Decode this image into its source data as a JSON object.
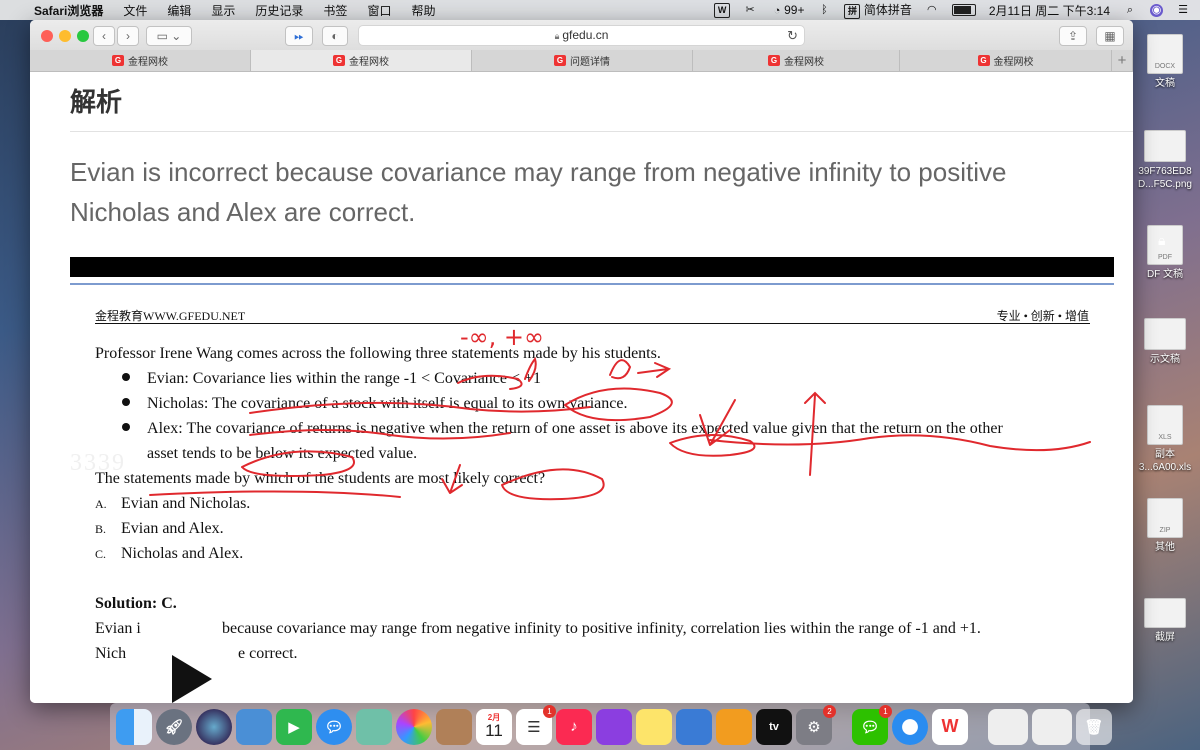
{
  "menubar": {
    "app_name": "Safari浏览器",
    "menus": [
      "文件",
      "编辑",
      "显示",
      "历史记录",
      "书签",
      "窗口",
      "帮助"
    ],
    "wechat_badge": "99+",
    "input_method": "简体拼音",
    "datetime": "2月11日 周二 下午3:14"
  },
  "safari": {
    "url": "gfedu.cn",
    "tabs": [
      {
        "label": "金程网校",
        "active": false
      },
      {
        "label": "金程网校",
        "active": true
      },
      {
        "label": "问题详情",
        "active": false
      },
      {
        "label": "金程网校",
        "active": false
      },
      {
        "label": "金程网校",
        "active": false
      }
    ]
  },
  "page": {
    "heading": "解析",
    "explanation_line1": "Evian is incorrect because covariance may range from negative infinity to positive",
    "explanation_line2": "Nicholas and Alex are correct."
  },
  "scan": {
    "header_left": "金程教育WWW.GFEDU.NET",
    "header_right": "专业 • 创新 • 增值",
    "question": "Professor Irene Wang comes across the following three statements made by his students.",
    "bullets": [
      "Evian: Covariance lies within the range -1 < Covariance < +1",
      "Nicholas: The covariance of a stock with itself is equal to its own variance.",
      "Alex: The covariance of returns is negative when the return of one asset is above its expected value given that the return on the other",
      "asset tends to be below its expected value."
    ],
    "prompt": "The statements made by which of the students are most likely correct?",
    "options": [
      {
        "letter": "A.",
        "text": "Evian and Nicholas."
      },
      {
        "letter": "B.",
        "text": "Evian and Alex."
      },
      {
        "letter": "C.",
        "text": "Nicholas and Alex."
      }
    ],
    "solution_label": "Solution: C.",
    "solution_line1_a": "Evian i",
    "solution_line1_b": "because covariance may range from negative infinity to positive infinity, correlation lies within the range of -1 and +1.",
    "solution_line2_a": "Nich",
    "solution_line2_b": "e correct.",
    "annotation_text": "-∞, +∞"
  },
  "desktop_icons": [
    {
      "label": "文稿",
      "tag": "DOCX"
    },
    {
      "label": "39F763ED8\nD...F5C.png",
      "tag": ""
    },
    {
      "label": "DF 文稿",
      "tag": "PDF"
    },
    {
      "label": "示文稿",
      "tag": ""
    },
    {
      "label": "副本\n3...6A00.xls",
      "tag": "XLS"
    },
    {
      "label": "其他",
      "tag": "ZIP"
    },
    {
      "label": "截屏",
      "tag": ""
    }
  ],
  "dock": {
    "calendar_month": "2月",
    "calendar_day": "11",
    "reminders_badge": "1",
    "prefs_badge": "2",
    "wechat_badge": "1",
    "tv_label": "tv"
  }
}
